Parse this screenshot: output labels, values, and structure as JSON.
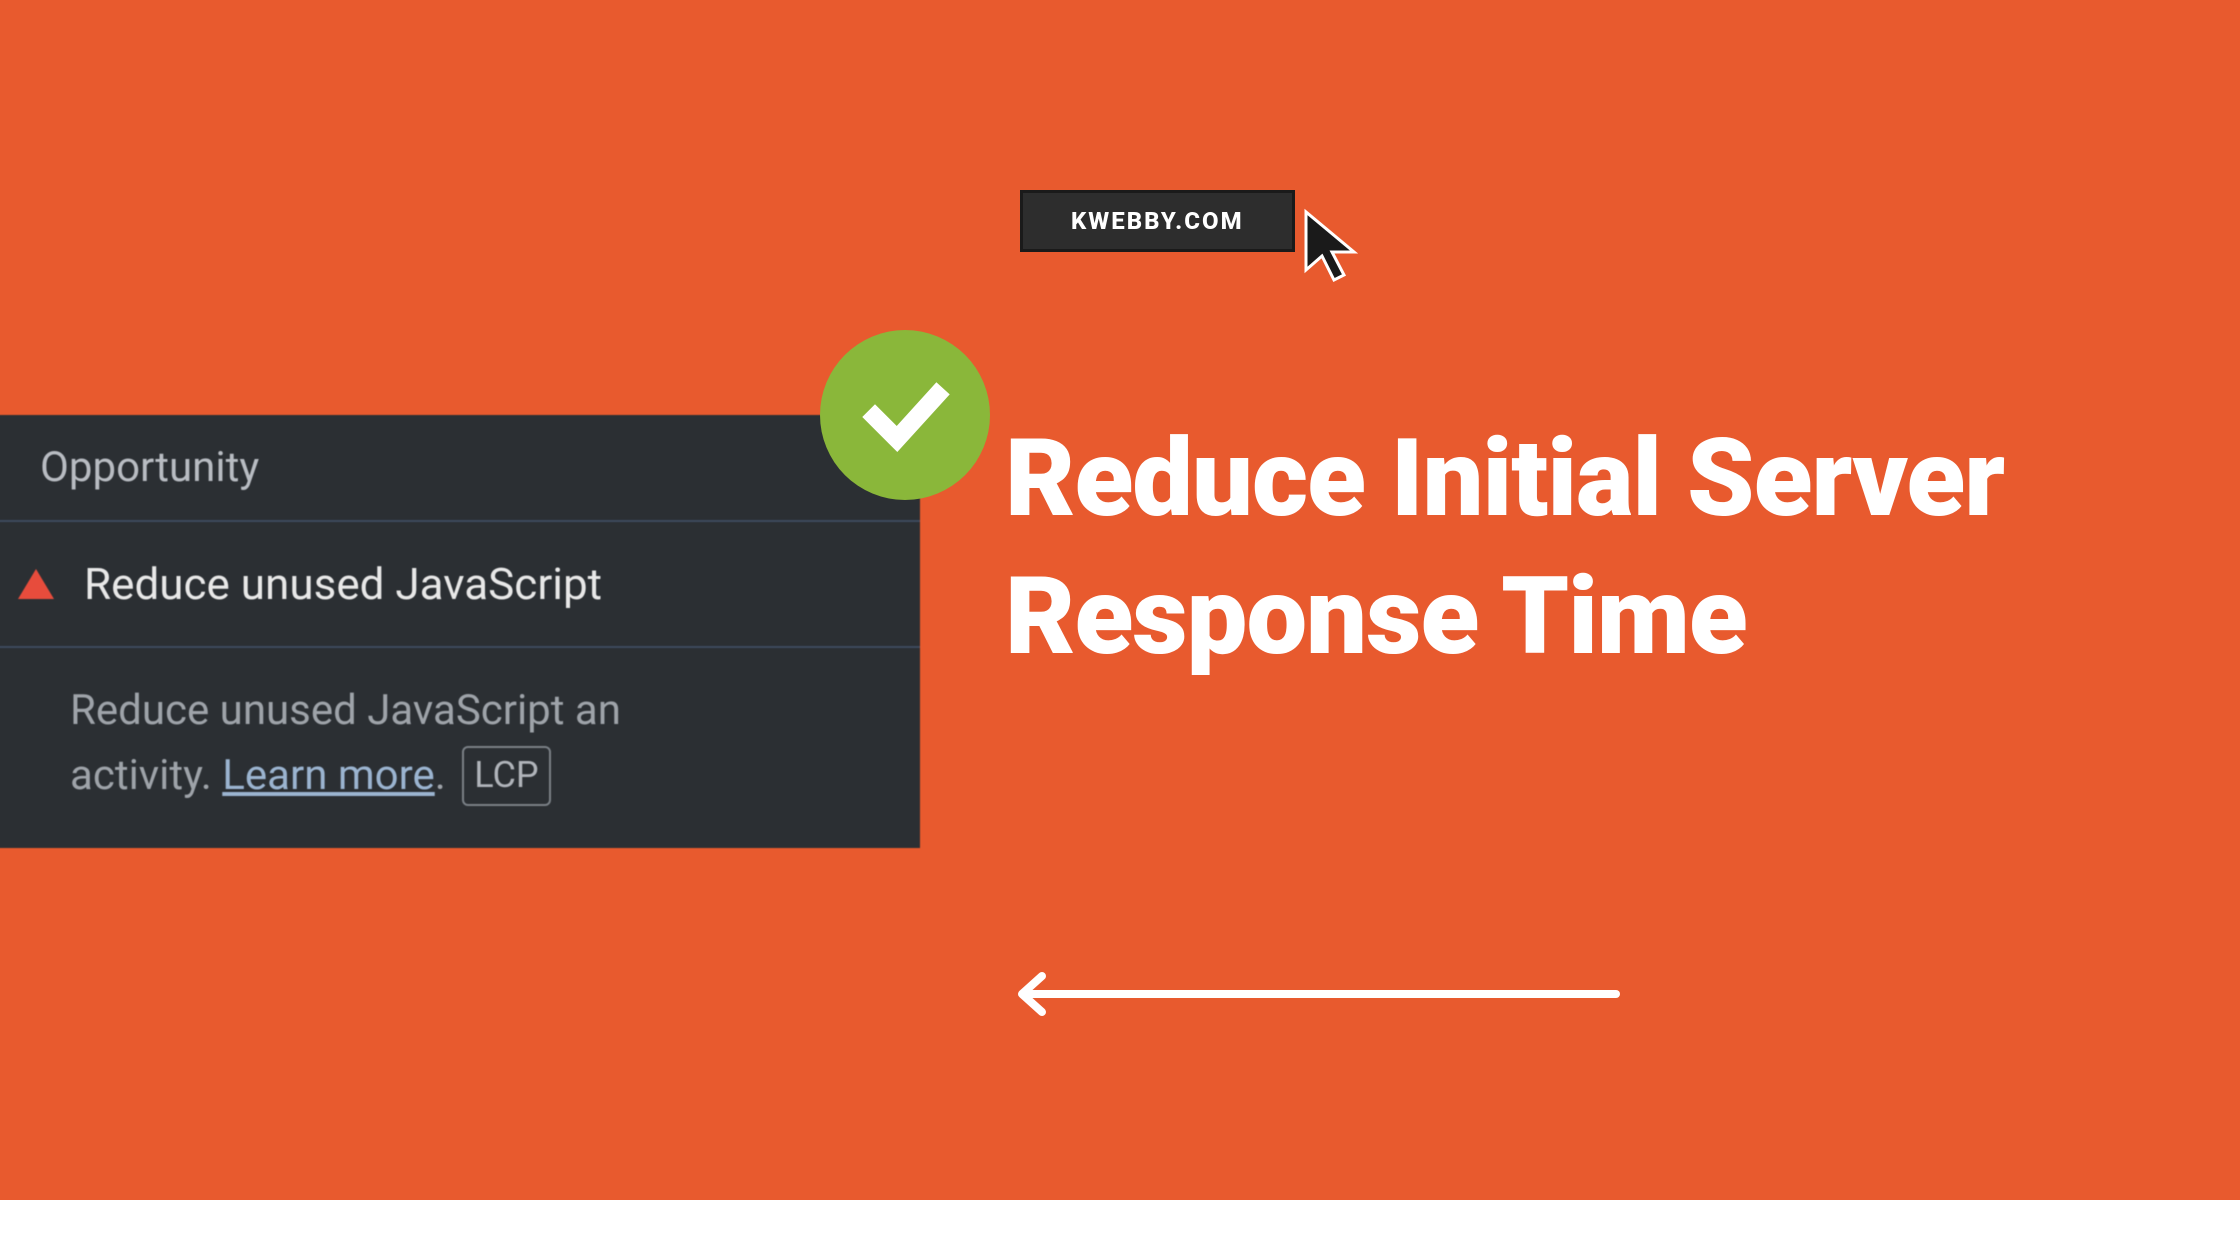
{
  "badge": {
    "label": "KWEBBY.COM"
  },
  "panel": {
    "header": "Opportunity",
    "item": "Reduce unused JavaScript",
    "detail_prefix": "Reduce unused JavaScript an",
    "detail_line2_prefix": "activity. ",
    "learn_more": "Learn more",
    "detail_suffix": ". ",
    "lcp_tag": "LCP"
  },
  "title": "Reduce Initial Server Response Time",
  "colors": {
    "bg": "#E85A2E",
    "accent_green": "#8AB73A",
    "dark": "#2B2F33"
  }
}
